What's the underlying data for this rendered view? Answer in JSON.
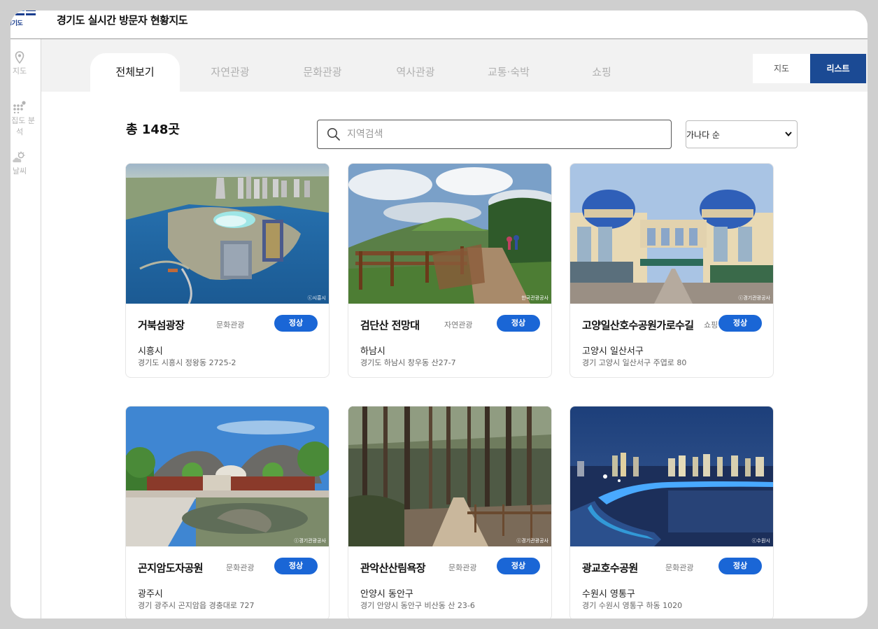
{
  "header": {
    "logo_text": "경기도",
    "title": "경기도 실시간 방문자 현황지도"
  },
  "sidebar": {
    "items": [
      {
        "label": "지도",
        "icon": "map-pin-icon"
      },
      {
        "label": "밀집도 분석",
        "icon": "density-icon"
      },
      {
        "label": "날씨",
        "icon": "weather-icon"
      }
    ]
  },
  "tabs": [
    {
      "label": "전체보기",
      "active": true
    },
    {
      "label": "자연관광",
      "active": false
    },
    {
      "label": "문화관광",
      "active": false
    },
    {
      "label": "역사관광",
      "active": false
    },
    {
      "label": "교통·숙박",
      "active": false
    },
    {
      "label": "쇼핑",
      "active": false
    }
  ],
  "view_toggle": {
    "map_label": "지도",
    "list_label": "리스트",
    "selected": "리스트"
  },
  "summary": {
    "total_text": "총 148곳"
  },
  "search": {
    "placeholder": "지역검색",
    "value": ""
  },
  "sort": {
    "selected": "가나다 순"
  },
  "colors": {
    "accent": "#1b4a94",
    "status_blue": "#1a66d6",
    "tab_bg": "#f2f2f2"
  },
  "cards": [
    {
      "name": "거북섬광장",
      "category": "문화관광",
      "status": "정상",
      "city": "시흥시",
      "address": "경기도 시흥시 정왕동 2725-2",
      "credit": "ⓒ시흥시"
    },
    {
      "name": "검단산 전망대",
      "category": "자연관광",
      "status": "정상",
      "city": "하남시",
      "address": "경기도 하남시 창우동 산27-7",
      "credit": "한국관광공사"
    },
    {
      "name": "고양일산호수공원가로수길",
      "category": "쇼핑",
      "status": "정상",
      "city": "고양시 일산서구",
      "address": "경기 고양시 일산서구 주엽로 80",
      "credit": "ⓒ경기관광공사"
    },
    {
      "name": "곤지암도자공원",
      "category": "문화관광",
      "status": "정상",
      "city": "광주시",
      "address": "경기 광주시 곤지암읍 경충대로 727",
      "credit": "ⓒ경기관광공사"
    },
    {
      "name": "관악산산림욕장",
      "category": "문화관광",
      "status": "정상",
      "city": "안양시 동안구",
      "address": "경기 안양시 동안구 비산동 산 23-6",
      "credit": "ⓒ경기관광공사"
    },
    {
      "name": "광교호수공원",
      "category": "문화관광",
      "status": "정상",
      "city": "수원시 영통구",
      "address": "경기 수원시 영통구 하동 1020",
      "credit": "ⓒ수원시"
    }
  ]
}
